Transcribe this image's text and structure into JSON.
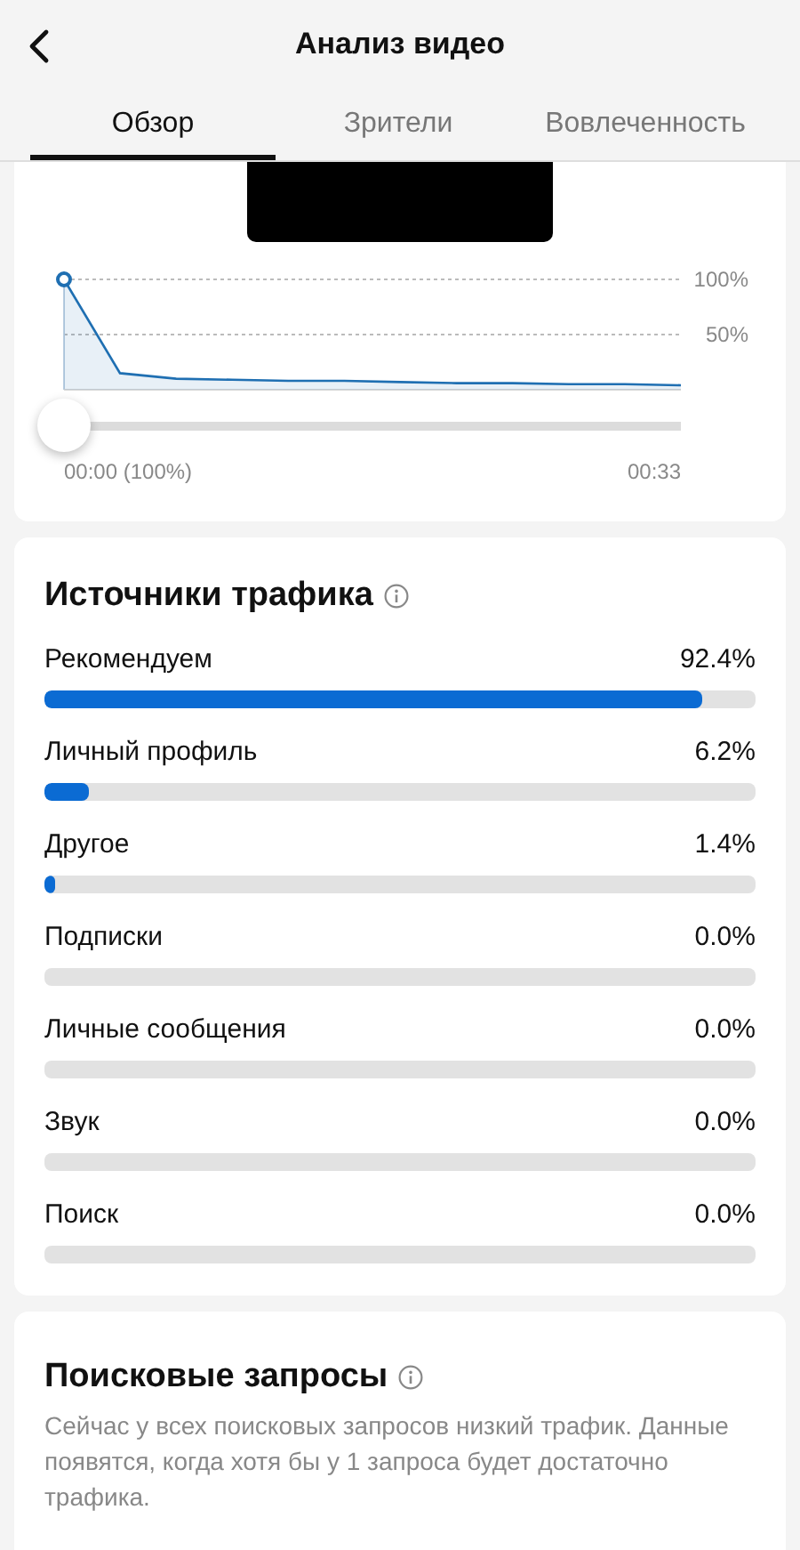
{
  "header": {
    "title": "Анализ видео"
  },
  "tabs": [
    {
      "label": "Обзор",
      "selected": true
    },
    {
      "label": "Зрители",
      "selected": false
    },
    {
      "label": "Вовлеченность",
      "selected": false
    }
  ],
  "retention": {
    "chart_data": {
      "type": "area",
      "categories": [
        null,
        null,
        null,
        null,
        null,
        null,
        null,
        null,
        null,
        null,
        null,
        null
      ],
      "series": [
        {
          "color": "#1f6fb2",
          "values": [
            100,
            15,
            10,
            9,
            8,
            8,
            7,
            6,
            6,
            5,
            5,
            4
          ]
        }
      ],
      "ylim": [
        0,
        100
      ],
      "yticks": [
        {
          "value": 100,
          "label": "100%"
        },
        {
          "value": 50,
          "label": "50%"
        }
      ]
    },
    "slider": {
      "level": 0
    },
    "start_label": "00:00 (100%)",
    "end_label": "00:33"
  },
  "traffic_sources": {
    "title": "Источники трафика",
    "rows": [
      {
        "label": "Рекомендуем",
        "value": "92.4%",
        "level": 0.924
      },
      {
        "label": "Личный профиль",
        "value": "6.2%",
        "level": 0.062
      },
      {
        "label": "Другое",
        "value": "1.4%",
        "level": 0.014
      },
      {
        "label": "Подписки",
        "value": "0.0%"
      },
      {
        "label": "Личные сообщения",
        "value": "0.0%"
      },
      {
        "label": "Звук",
        "value": "0.0%"
      },
      {
        "label": "Поиск",
        "value": "0.0%"
      }
    ]
  },
  "search_queries": {
    "title": "Поисковые запросы",
    "message": "Сейчас у всех поисковых запросов низкий трафик. Данные появятся, когда хотя бы у 1 запроса будет достаточно трафика."
  }
}
